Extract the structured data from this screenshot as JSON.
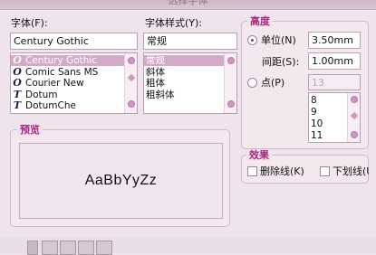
{
  "window": {
    "title": "选择字体"
  },
  "font": {
    "label": "字体(F):",
    "value": "Century Gothic",
    "items": [
      "Century Gothic",
      "Comic Sans MS",
      "Courier New",
      "Dotum",
      "DotumChe"
    ],
    "icons": [
      "O",
      "O",
      "O",
      "T",
      "T"
    ],
    "selected_index": 0
  },
  "style": {
    "label": "字体样式(Y):",
    "value": "常规",
    "items": [
      "常规",
      "斜体",
      "粗体",
      "粗斜体"
    ],
    "selected_index": 0
  },
  "height": {
    "legend": "高度",
    "unit_label": "单位(N)",
    "unit_value": "3.50mm",
    "spacing_label": "间距(S):",
    "spacing_value": "1.00mm",
    "point_label": "点(P)",
    "point_value": "13",
    "point_items": [
      "8",
      "9",
      "10",
      "11"
    ]
  },
  "preview": {
    "legend": "预览",
    "sample": "AaBbYyZz"
  },
  "effects": {
    "legend": "效果",
    "strikethrough_label": "删除线(K)",
    "underline_label": "下划线(U)"
  },
  "icons": {
    "radio_selected": "radio-on",
    "scroll_knob": "circle-knob",
    "scroll_thumb": "diamond"
  },
  "colors": {
    "background": "#efe3ec",
    "accent": "#a7277f",
    "selection": "#d5a9c8"
  }
}
